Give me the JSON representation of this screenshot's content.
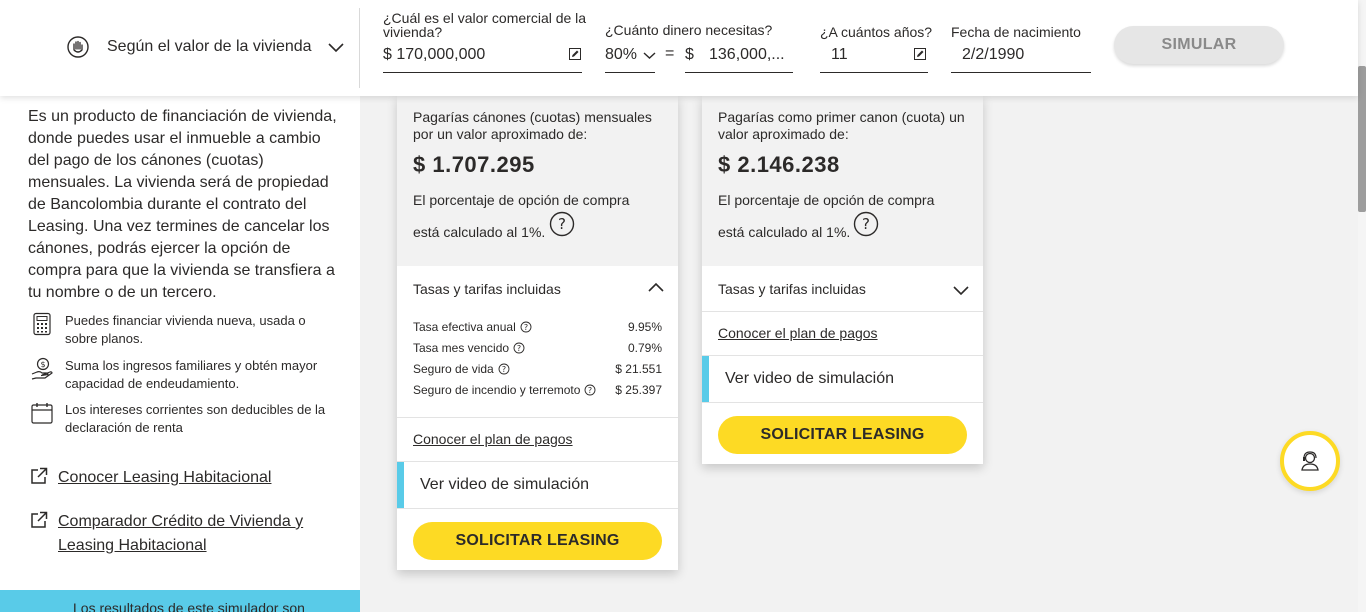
{
  "topbar": {
    "mode_label": "Según el valor de la vivienda",
    "field_valor": {
      "label": "¿Cuál es el valor comercial de la vivienda?",
      "value": "$ 170,000,000"
    },
    "field_dinero": {
      "label": "¿Cuánto dinero necesitas?",
      "percent": "80%",
      "equals": "=",
      "currency": "$",
      "value": "136,000,..."
    },
    "field_anios": {
      "label": "¿A cuántos años?",
      "value": "11"
    },
    "field_nacimiento": {
      "label": "Fecha de nacimiento",
      "value": "2/2/1990"
    },
    "simular_label": "SIMULAR"
  },
  "left": {
    "intro": "Es un producto de financiación de vivienda, donde puedes usar el inmueble a cambio del pago de los cánones (cuotas) mensuales. La vivienda será de propiedad de Bancolombia durante el contrato del Leasing. Una vez termines de cancelar los cánones, podrás ejercer la opción de compra para que la vivienda se transfiera a tu nombre o de un tercero.",
    "features": [
      {
        "icon": "calculator-icon",
        "text": "Puedes financiar vivienda nueva, usada o sobre planos."
      },
      {
        "icon": "money-hand-icon",
        "text": "Suma los ingresos familiares y obtén mayor capacidad de endeudamiento."
      },
      {
        "icon": "calendar-icon",
        "text": "Los intereses corrientes son deducibles de la declaración de renta"
      }
    ],
    "links": [
      {
        "text": "Conocer Leasing Habitacional"
      },
      {
        "text": "Comparador Crédito de Vivienda y Leasing Habitacional"
      }
    ],
    "disclaimer": "Los resultados de este simulador son"
  },
  "card1": {
    "desc": "Pagarías cánones (cuotas) mensuales por un valor aproximado de:",
    "amount": "$ 1.707.295",
    "option_line1": "El porcentaje de opción de compra",
    "option_line2": "está calculado al 1%.",
    "tasas_title": "Tasas y tarifas incluidas",
    "fees": [
      {
        "name": "Tasa efectiva anual",
        "value": "9.95%"
      },
      {
        "name": "Tasa mes vencido",
        "value": "0.79%"
      },
      {
        "name": "Seguro de vida",
        "value": "$ 21.551"
      },
      {
        "name": "Seguro de incendio y terremoto",
        "value": "$ 25.397"
      }
    ],
    "plan_link": "Conocer el plan de pagos",
    "video_label": "Ver video de simulación",
    "button_label": "SOLICITAR LEASING"
  },
  "card2": {
    "desc": "Pagarías como primer canon (cuota) un valor aproximado de:",
    "amount": "$ 2.146.238",
    "option_line1": "El porcentaje de opción de compra",
    "option_line2": "está calculado al 1%.",
    "tasas_title": "Tasas y tarifas incluidas",
    "plan_link": "Conocer el plan de pagos",
    "video_label": "Ver video de simulación",
    "button_label": "SOLICITAR LEASING"
  },
  "colors": {
    "accent": "#fdda24",
    "info": "#59cbe8",
    "text": "#2c2a29",
    "background": "#f2f2f2"
  }
}
